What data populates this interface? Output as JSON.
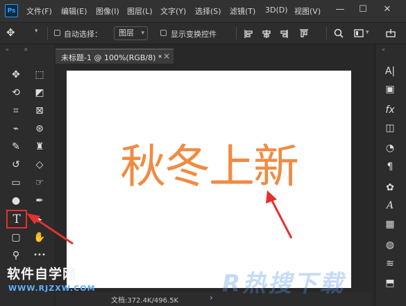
{
  "app": {
    "logo": "Ps"
  },
  "menubar": {
    "items": [
      "文件(F)",
      "编辑(E)",
      "图像(I)",
      "图层(L)",
      "文字(Y)",
      "选择(S)",
      "滤镜(T)",
      "3D(D)",
      "视图(V)"
    ]
  },
  "window_controls": {
    "minimize": "—",
    "maximize": "☐",
    "close": "✕"
  },
  "options_bar": {
    "auto_select_label": "自动选择：",
    "auto_select_target": "图层",
    "show_transform_label": "显示变换控件"
  },
  "document": {
    "tab_title": "未标题-1 @ 100%(RGB/8) *",
    "tab_close": "×",
    "canvas_text": "秋冬上新",
    "canvas_text_color": "#f08b42",
    "status": "文档:372.4K/496.5K",
    "status_arrow": "›"
  },
  "tools": {
    "move": "✥",
    "marquee": "⬚",
    "lasso": "⟲",
    "object_select": "◩",
    "crop": "⌗",
    "frame": "⊠",
    "eyedropper": "⌁",
    "patch": "⊛",
    "brush": "✎",
    "stamp": "♜",
    "history_brush": "↺",
    "eraser": "◇",
    "gradient": "▭",
    "smudge": "☞",
    "dodge": "●",
    "pen": "✒",
    "type": "T",
    "path_select": "▸",
    "shape": "▢",
    "hand": "✋",
    "zoom": "⚲",
    "more": "•••"
  },
  "right_panel": {
    "items": [
      "A|",
      "▣",
      "fx",
      "◫",
      "◔",
      "¶",
      "✿",
      "A",
      "▦",
      "◍",
      "≋",
      "⬒"
    ]
  },
  "watermarks": {
    "left_text": "软件自学网",
    "left_url": "WWW.RJZXW.COM",
    "right_text": "R热搜下载"
  },
  "colors": {
    "accent_red": "#e43030",
    "ps_blue": "#31a8ff"
  }
}
